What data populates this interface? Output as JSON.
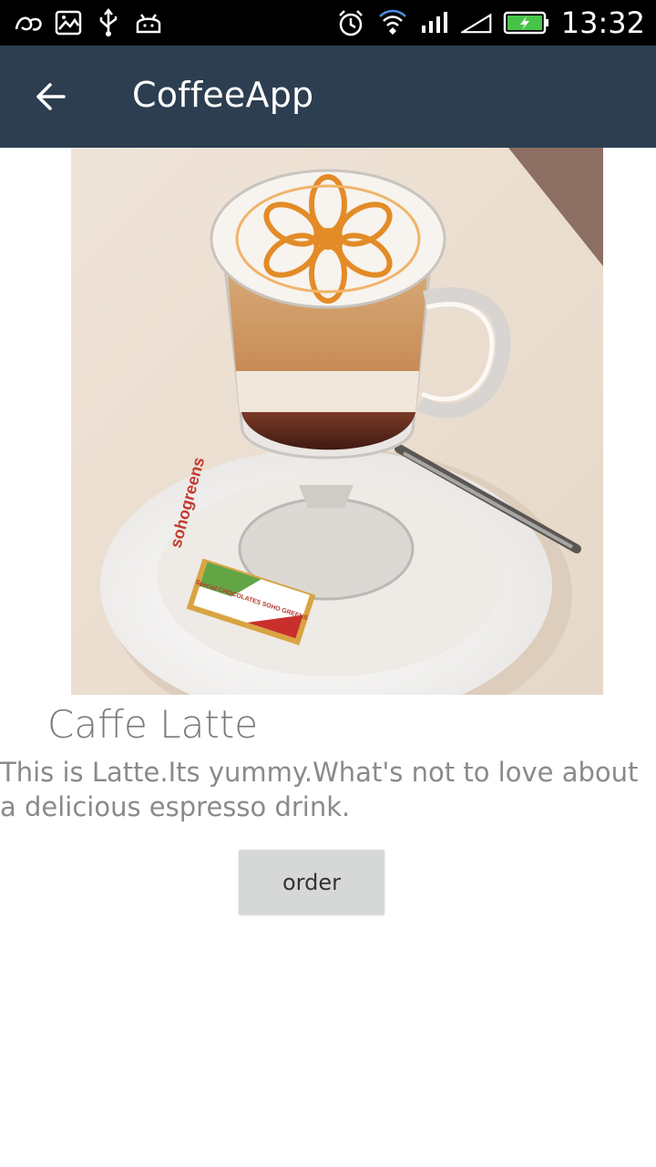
{
  "status_bar": {
    "time": "13:32",
    "left_icons": [
      "alipay-icon",
      "gallery-icon",
      "usb-icon",
      "android-debug-icon"
    ],
    "right_icons": [
      "alarm-icon",
      "wifi-icon",
      "signal-icon",
      "signal-empty-icon",
      "battery-charging-icon"
    ]
  },
  "app_bar": {
    "title": "CoffeeApp",
    "back_icon": "arrow-back-icon",
    "color": "#2c3e50"
  },
  "content": {
    "image_alt": "coffee-latte-photo",
    "image_text": {
      "saucer": "sohogreens",
      "chocolate": "Special CHOCOLATES SOHO GREENS"
    },
    "name": "Caffe Latte",
    "description": "This is Latte.Its yummy.What's not to love about a delicious espresso drink.",
    "order_label": "order"
  }
}
